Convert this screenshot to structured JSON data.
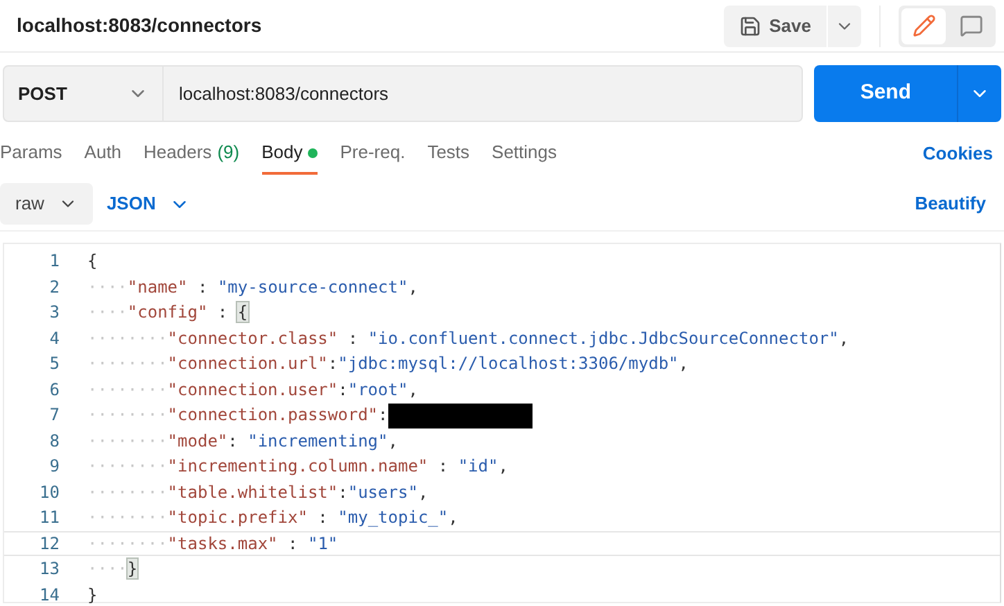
{
  "title": "localhost:8083/connectors",
  "save": {
    "label": "Save"
  },
  "mode_toggle": [
    {
      "kind": "edit",
      "selected": true
    },
    {
      "kind": "comment",
      "selected": false
    }
  ],
  "request": {
    "method": "POST",
    "url": "localhost:8083/connectors",
    "send": "Send"
  },
  "tabs": [
    {
      "label": "Params",
      "selected": false
    },
    {
      "label": "Auth",
      "selected": false
    },
    {
      "label": "Headers",
      "count": "(9)",
      "selected": false
    },
    {
      "label": "Body",
      "dot": true,
      "selected": true
    },
    {
      "label": "Pre-req.",
      "selected": false
    },
    {
      "label": "Tests",
      "selected": false
    },
    {
      "label": "Settings",
      "selected": false
    }
  ],
  "cookies": "Cookies",
  "body_type": "raw",
  "language": "JSON",
  "beautify": "Beautify",
  "editor": {
    "lines": [
      {
        "number": "1",
        "selected": false,
        "tokens": [
          {
            "kind": "punct",
            "text": "{"
          }
        ]
      },
      {
        "number": "2",
        "indent": "····",
        "selected": false,
        "tokens": [
          {
            "kind": "key",
            "text": "\"name\""
          },
          {
            "kind": "punct",
            "text": " : "
          },
          {
            "kind": "string",
            "text": "\"my-source-connect\""
          },
          {
            "kind": "punct",
            "text": ","
          }
        ]
      },
      {
        "number": "3",
        "indent": "····",
        "selected": false,
        "tokens": [
          {
            "kind": "key",
            "text": "\"config\""
          },
          {
            "kind": "punct",
            "text": " : "
          },
          {
            "kind": "bracket",
            "text": "{"
          }
        ]
      },
      {
        "number": "4",
        "indent": "········",
        "selected": false,
        "tokens": [
          {
            "kind": "key",
            "text": "\"connector.class\""
          },
          {
            "kind": "punct",
            "text": " : "
          },
          {
            "kind": "string",
            "text": "\"io.confluent.connect.jdbc.JdbcSourceConnector\""
          },
          {
            "kind": "punct",
            "text": ","
          }
        ]
      },
      {
        "number": "5",
        "indent": "········",
        "selected": false,
        "tokens": [
          {
            "kind": "key",
            "text": "\"connection.url\""
          },
          {
            "kind": "punct",
            "text": ":"
          },
          {
            "kind": "string",
            "text": "\"jdbc:mysql://localhost:3306/mydb\""
          },
          {
            "kind": "punct",
            "text": ","
          }
        ]
      },
      {
        "number": "6",
        "indent": "········",
        "selected": false,
        "tokens": [
          {
            "kind": "key",
            "text": "\"connection.user\""
          },
          {
            "kind": "punct",
            "text": ":"
          },
          {
            "kind": "string",
            "text": "\"root\""
          },
          {
            "kind": "punct",
            "text": ","
          }
        ]
      },
      {
        "number": "7",
        "indent": "········",
        "selected": false,
        "tokens": [
          {
            "kind": "key",
            "text": "\"connection.password\""
          },
          {
            "kind": "punct",
            "text": ":"
          },
          {
            "kind": "redacted"
          }
        ]
      },
      {
        "number": "8",
        "indent": "········",
        "selected": false,
        "tokens": [
          {
            "kind": "key",
            "text": "\"mode\""
          },
          {
            "kind": "punct",
            "text": ": "
          },
          {
            "kind": "string",
            "text": "\"incrementing\""
          },
          {
            "kind": "punct",
            "text": ","
          }
        ]
      },
      {
        "number": "9",
        "indent": "········",
        "selected": false,
        "tokens": [
          {
            "kind": "key",
            "text": "\"incrementing.column.name\""
          },
          {
            "kind": "punct",
            "text": " : "
          },
          {
            "kind": "string",
            "text": "\"id\""
          },
          {
            "kind": "punct",
            "text": ","
          }
        ]
      },
      {
        "number": "10",
        "indent": "········",
        "selected": false,
        "tokens": [
          {
            "kind": "key",
            "text": "\"table.whitelist\""
          },
          {
            "kind": "punct",
            "text": ":"
          },
          {
            "kind": "string",
            "text": "\"users\""
          },
          {
            "kind": "punct",
            "text": ","
          }
        ]
      },
      {
        "number": "11",
        "indent": "········",
        "selected": false,
        "tokens": [
          {
            "kind": "key",
            "text": "\"topic.prefix\""
          },
          {
            "kind": "punct",
            "text": " : "
          },
          {
            "kind": "string",
            "text": "\"my_topic_\""
          },
          {
            "kind": "punct",
            "text": ","
          }
        ]
      },
      {
        "number": "12",
        "indent": "········",
        "selected": true,
        "tokens": [
          {
            "kind": "key",
            "text": "\"tasks.max\""
          },
          {
            "kind": "punct",
            "text": " : "
          },
          {
            "kind": "string",
            "text": "\"1\""
          }
        ]
      },
      {
        "number": "13",
        "indent": "····",
        "selected": false,
        "tokens": [
          {
            "kind": "bracket",
            "text": "}"
          }
        ]
      },
      {
        "number": "14",
        "selected": false,
        "tokens": [
          {
            "kind": "punct",
            "text": "}"
          }
        ]
      }
    ]
  }
}
